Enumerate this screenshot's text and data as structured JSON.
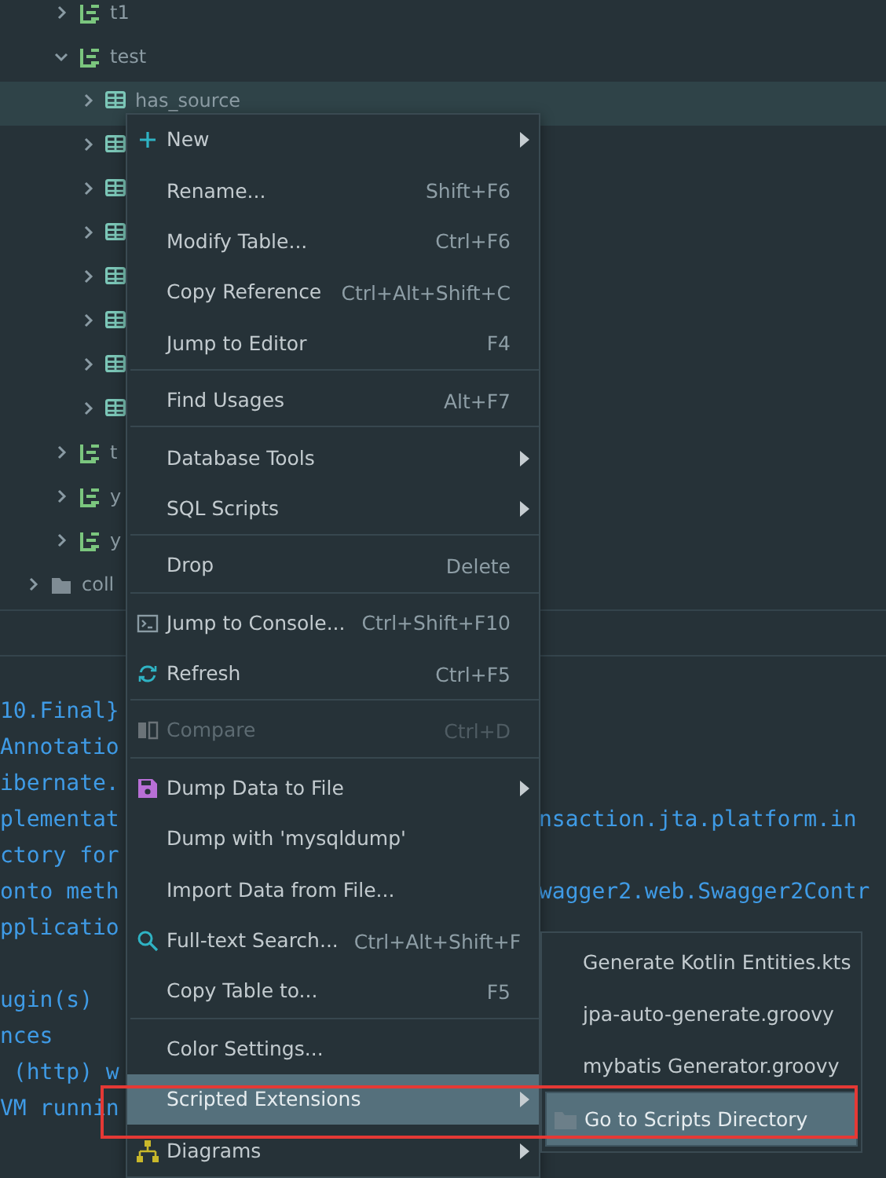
{
  "tree": [
    {
      "kind": "schema",
      "label": "t1",
      "expanded": false,
      "selected": false
    },
    {
      "kind": "schema",
      "label": "test",
      "expanded": true,
      "selected": false,
      "children": [
        {
          "kind": "table",
          "label": "has_source",
          "expanded": false,
          "selected": true
        },
        {
          "kind": "table",
          "expanded": false,
          "selected": false
        },
        {
          "kind": "table",
          "expanded": false,
          "selected": false
        },
        {
          "kind": "table",
          "expanded": false,
          "selected": false
        },
        {
          "kind": "table",
          "expanded": false,
          "selected": false
        },
        {
          "kind": "table",
          "expanded": false,
          "selected": false
        },
        {
          "kind": "table",
          "expanded": false,
          "selected": false
        },
        {
          "kind": "table",
          "expanded": false,
          "selected": false
        }
      ]
    },
    {
      "kind": "schema",
      "label": "t",
      "expanded": false,
      "selected": false
    },
    {
      "kind": "schema",
      "label": "y",
      "expanded": false,
      "selected": false
    },
    {
      "kind": "schema",
      "label": "y",
      "expanded": false,
      "selected": false
    },
    {
      "kind": "folder",
      "label": "coll",
      "expanded": false,
      "selected": false
    }
  ],
  "console": [
    {
      "kind": "text",
      "left": "10.Final}"
    },
    {
      "kind": "text",
      "left": "Annotatio"
    },
    {
      "kind": "text",
      "left": "ibernate."
    },
    {
      "kind": "text",
      "left": "plementat",
      "right": "nsaction.jta.platform.in"
    },
    {
      "kind": "text",
      "left": "ctory for"
    },
    {
      "kind": "text",
      "left": "onto meth",
      "right": "wagger2.web.Swagger2Contr"
    },
    {
      "kind": "text",
      "left": "pplicatio"
    },
    {
      "kind": "blank"
    },
    {
      "kind": "text",
      "left": "ugin(s)"
    },
    {
      "kind": "text",
      "left": "nces"
    },
    {
      "kind": "text",
      "left": " (http) w"
    },
    {
      "kind": "text",
      "left": "VM runnin"
    }
  ],
  "context_menu": [
    {
      "kind": "new",
      "label": "New",
      "submenu": true,
      "selected": false,
      "disabled": false
    },
    {
      "kind": "plain",
      "label": "Rename...",
      "shortcut": "Shift+F6",
      "submenu": false,
      "selected": false,
      "disabled": false
    },
    {
      "kind": "plain",
      "label": "Modify Table...",
      "shortcut": "Ctrl+F6",
      "submenu": false,
      "selected": false,
      "disabled": false
    },
    {
      "kind": "plain",
      "label": "Copy Reference",
      "shortcut": "Ctrl+Alt+Shift+C",
      "submenu": false,
      "selected": false,
      "disabled": false
    },
    {
      "kind": "plain",
      "label": "Jump to Editor",
      "shortcut": "F4",
      "submenu": false,
      "selected": false,
      "disabled": false
    },
    {
      "kind": "separator"
    },
    {
      "kind": "plain",
      "label": "Find Usages",
      "shortcut": "Alt+F7",
      "submenu": false,
      "selected": false,
      "disabled": false
    },
    {
      "kind": "separator"
    },
    {
      "kind": "plain",
      "label": "Database Tools",
      "submenu": true,
      "selected": false,
      "disabled": false
    },
    {
      "kind": "plain",
      "label": "SQL Scripts",
      "submenu": true,
      "selected": false,
      "disabled": false
    },
    {
      "kind": "separator"
    },
    {
      "kind": "plain",
      "label": "Drop",
      "shortcut": "Delete",
      "submenu": false,
      "selected": false,
      "disabled": false
    },
    {
      "kind": "separator"
    },
    {
      "kind": "console",
      "label": "Jump to Console...",
      "shortcut": "Ctrl+Shift+F10",
      "submenu": false,
      "selected": false,
      "disabled": false
    },
    {
      "kind": "refresh",
      "label": "Refresh",
      "shortcut": "Ctrl+F5",
      "submenu": false,
      "selected": false,
      "disabled": false
    },
    {
      "kind": "separator"
    },
    {
      "kind": "compare",
      "label": "Compare",
      "shortcut": "Ctrl+D",
      "submenu": false,
      "selected": false,
      "disabled": true
    },
    {
      "kind": "separator"
    },
    {
      "kind": "dump",
      "label": "Dump Data to File",
      "submenu": true,
      "selected": false,
      "disabled": false
    },
    {
      "kind": "plain",
      "label": "Dump with 'mysqldump'",
      "submenu": false,
      "selected": false,
      "disabled": false
    },
    {
      "kind": "plain",
      "label": "Import Data from File...",
      "submenu": false,
      "selected": false,
      "disabled": false
    },
    {
      "kind": "search",
      "label": "Full-text Search...",
      "shortcut": "Ctrl+Alt+Shift+F",
      "submenu": false,
      "selected": false,
      "disabled": false
    },
    {
      "kind": "plain",
      "label": "Copy Table to...",
      "shortcut": "F5",
      "submenu": false,
      "selected": false,
      "disabled": false
    },
    {
      "kind": "separator"
    },
    {
      "kind": "plain",
      "label": "Color Settings...",
      "submenu": false,
      "selected": false,
      "disabled": false
    },
    {
      "kind": "plain",
      "label": "Scripted Extensions",
      "submenu": true,
      "selected": true,
      "disabled": false
    },
    {
      "kind": "diagram",
      "label": "Diagrams",
      "submenu": true,
      "selected": false,
      "disabled": false
    }
  ],
  "submenu": [
    {
      "kind": "script",
      "label": "Generate Kotlin Entities.kts",
      "selected": false
    },
    {
      "kind": "script",
      "label": "jpa-auto-generate.groovy",
      "selected": false
    },
    {
      "kind": "script",
      "label": "mybatis Generator.groovy",
      "selected": false
    },
    {
      "kind": "folder",
      "label": "Go to Scripts Directory",
      "selected": true
    }
  ],
  "annotations": [
    {
      "kind": "box"
    }
  ]
}
